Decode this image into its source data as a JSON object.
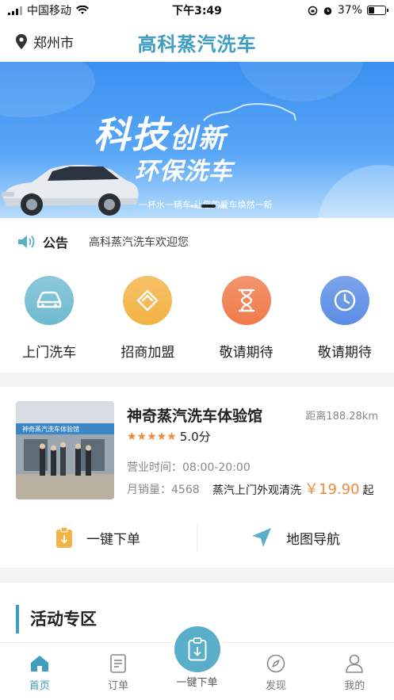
{
  "status_bar": {
    "carrier": "中国移动",
    "time": "下午3:49",
    "battery": "37%",
    "battery_level": 0.37
  },
  "header": {
    "location": "郑州市",
    "app_title": "高科蒸汽洗车"
  },
  "banner": {
    "title_main": "科技",
    "title_small": "创新",
    "title_line2": "环保洗车",
    "slogan": "一杯水一辆车   让您的爱车焕然一新",
    "slide_count": 3,
    "active_slide": 1
  },
  "notice": {
    "label": "公告",
    "text": "高科蒸汽洗车欢迎您"
  },
  "menu": {
    "items": [
      {
        "label": "上门洗车",
        "color": "#6fbad0",
        "icon": "car-icon"
      },
      {
        "label": "招商加盟",
        "color": "#f3b243",
        "icon": "handshake-icon"
      },
      {
        "label": "敬请期待",
        "color": "#f07a4a",
        "icon": "hourglass-icon"
      },
      {
        "label": "敬请期待",
        "color": "#5b8de4",
        "icon": "clock-icon"
      }
    ]
  },
  "store": {
    "name": "神奇蒸汽洗车体验馆",
    "distance": "距离188.28km",
    "rating_stars": 5,
    "score": "5.0分",
    "hours": "营业时间：08:00-20:00",
    "monthly_sales": "月销量：4568",
    "service": "蒸汽上门外观清洗",
    "price": "￥19.90",
    "price_suffix": "起",
    "photo_sign": "神奇蒸汽洗车体验馆",
    "actions": {
      "order": "一键下单",
      "navigate": "地图导航"
    }
  },
  "activity": {
    "title": "活动专区"
  },
  "tabbar": {
    "items": [
      {
        "label": "首页",
        "icon": "home-icon"
      },
      {
        "label": "订单",
        "icon": "order-icon"
      },
      {
        "label": "一键下单",
        "icon": "quick-order-icon"
      },
      {
        "label": "发现",
        "icon": "compass-icon"
      },
      {
        "label": "我的",
        "icon": "user-icon"
      }
    ],
    "active_index": 0
  },
  "colors": {
    "brand": "#3d9ec0",
    "accent": "#f08a3a"
  }
}
